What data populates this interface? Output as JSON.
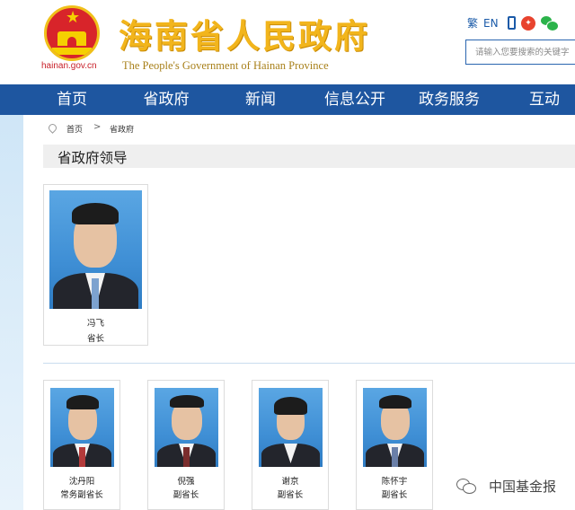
{
  "header": {
    "domain": "hainan.gov.cn",
    "title": "海南省人民政府",
    "subtitle": "The People's Government  of Hainan Province",
    "tools": {
      "traditional": "繁",
      "english": "EN"
    },
    "search_placeholder": "请输入您要搜索的关键字"
  },
  "nav": {
    "items": [
      {
        "label": "首页"
      },
      {
        "label": "省政府"
      },
      {
        "label": "新闻"
      },
      {
        "label": "信息公开"
      },
      {
        "label": "政务服务"
      },
      {
        "label": "互动"
      }
    ]
  },
  "breadcrumb": {
    "home": "首页",
    "separator": ">",
    "current": "省政府"
  },
  "section": {
    "title": "省政府领导"
  },
  "leaders": {
    "governor": {
      "name": "冯飞",
      "title": "省长"
    },
    "deputies": [
      {
        "name": "沈丹阳",
        "title": "常务副省长",
        "tie_color": "#b33a3a"
      },
      {
        "name": "倪强",
        "title": "副省长",
        "tie_color": "#7a2d2d"
      },
      {
        "name": "谢京",
        "title": "副省长",
        "tie_color": ""
      },
      {
        "name": "陈怀宇",
        "title": "副省长",
        "tie_color": "#6a7fa8"
      }
    ]
  },
  "watermark": {
    "text": "中国基金报"
  },
  "colors": {
    "nav_bg": "#1e56a0",
    "title_gold": "#f2b51c",
    "emblem_red": "#d8242a",
    "photo_blue": "#3f8fd5"
  }
}
